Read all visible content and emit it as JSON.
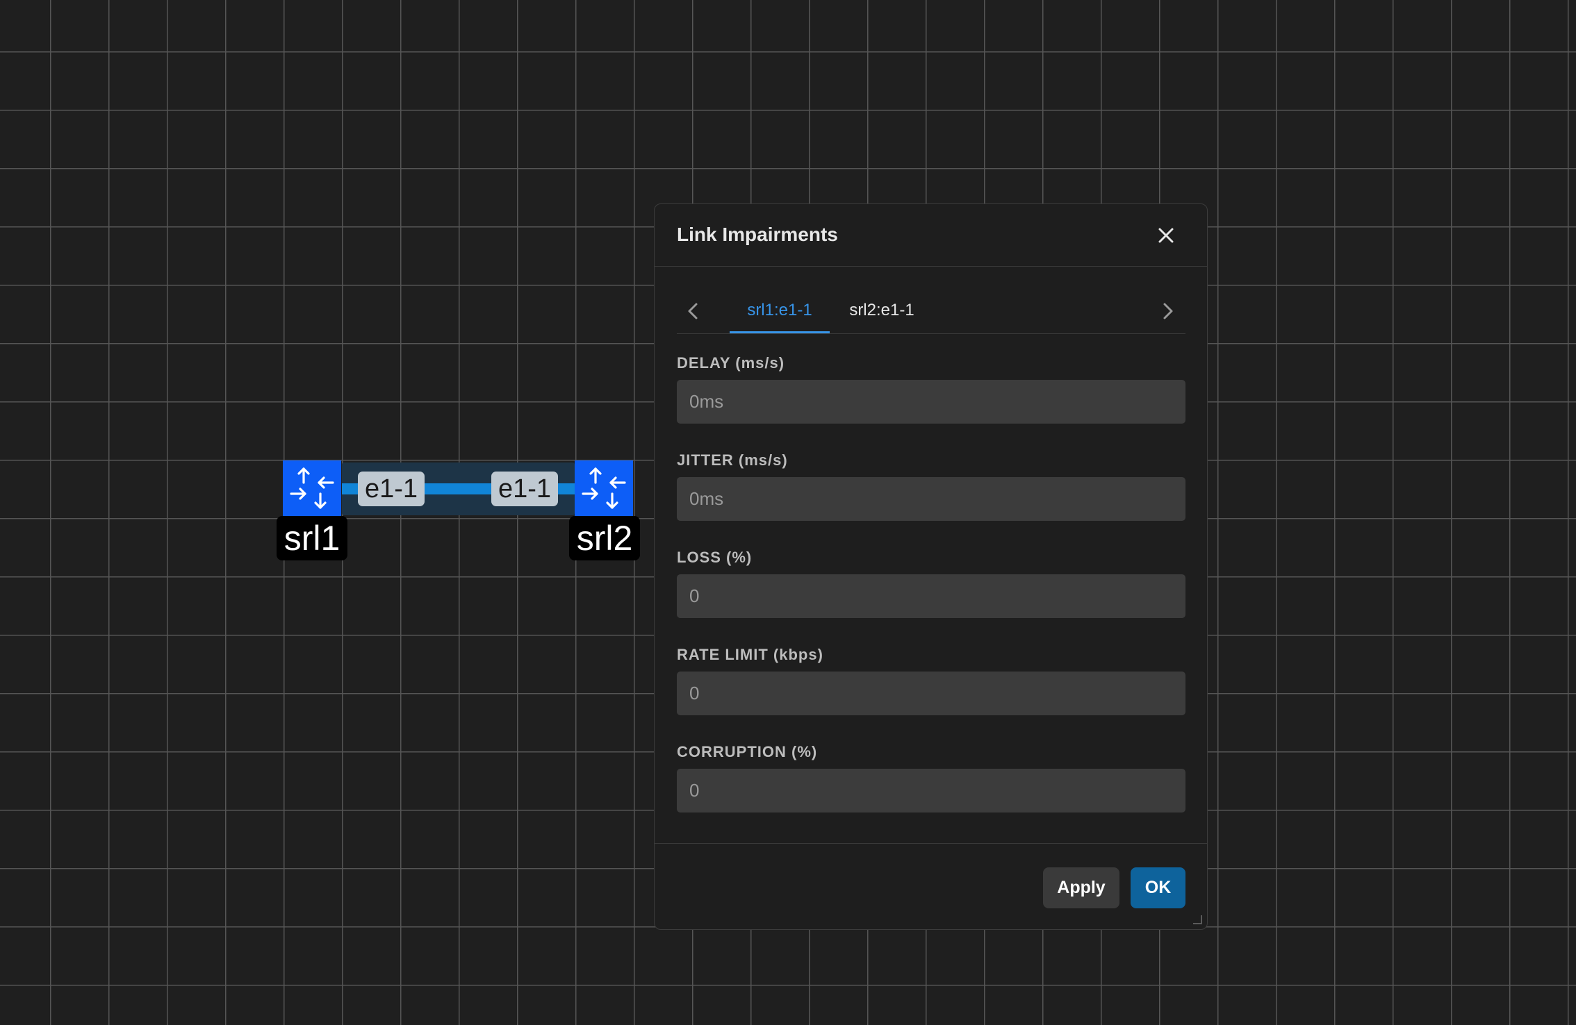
{
  "topology": {
    "nodes": [
      {
        "name": "srl1",
        "icon": "router-icon"
      },
      {
        "name": "srl2",
        "icon": "router-icon"
      }
    ],
    "link": {
      "endpoint_a": "e1-1",
      "endpoint_b": "e1-1"
    }
  },
  "dialog": {
    "title": "Link Impairments",
    "tabs": [
      {
        "label": "srl1:e1-1",
        "active": true
      },
      {
        "label": "srl2:e1-1",
        "active": false
      }
    ],
    "fields": {
      "delay": {
        "label": "DELAY (ms/s)",
        "value": "",
        "placeholder": "0ms"
      },
      "jitter": {
        "label": "JITTER (ms/s)",
        "value": "",
        "placeholder": "0ms"
      },
      "loss": {
        "label": "LOSS (%)",
        "value": "",
        "placeholder": "0"
      },
      "rate_limit": {
        "label": "RATE LIMIT (kbps)",
        "value": "",
        "placeholder": "0"
      },
      "corruption": {
        "label": "CORRUPTION (%)",
        "value": "",
        "placeholder": "0"
      }
    },
    "buttons": {
      "apply": "Apply",
      "ok": "OK"
    }
  },
  "colors": {
    "node": "#0d5ef7",
    "link": "#1185d8",
    "accent": "#3794e8",
    "primary_button": "#0e639c",
    "background": "#1f1f1f"
  }
}
